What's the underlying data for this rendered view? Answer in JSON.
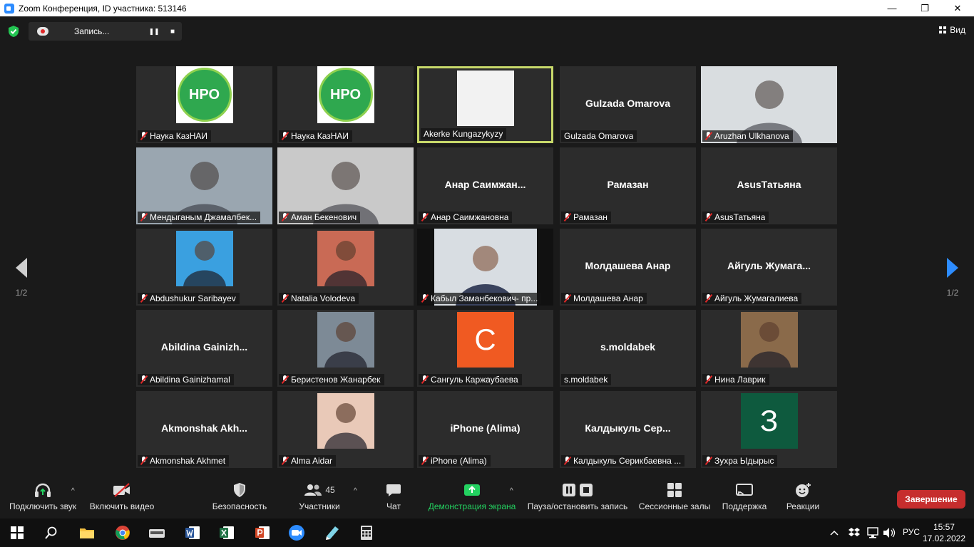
{
  "window": {
    "title": "Zoom Конференция, ID участника: 513146",
    "controls": [
      "—",
      "❐",
      "✕"
    ]
  },
  "recording": {
    "label": "Запись...",
    "pause": "❚❚",
    "stop": "■"
  },
  "view": {
    "label": "Вид"
  },
  "pagination": {
    "left": "1/2",
    "right": "1/2"
  },
  "tiles": [
    {
      "label": "Наука КазНАИ",
      "kind": "logo",
      "logo_text": "НРО",
      "muted": true
    },
    {
      "label": "Наука КазНАИ",
      "kind": "logo",
      "logo_text": "НРО",
      "muted": true
    },
    {
      "label": "Akerke Kungazykyzy",
      "kind": "white",
      "muted": false,
      "active": true
    },
    {
      "label": "Gulzada Omarova",
      "kind": "name",
      "big": "Gulzada Omarova",
      "muted": false
    },
    {
      "label": "Aruzhan Ulkhanova",
      "kind": "fullphoto",
      "bg": "#d9dde0",
      "muted": true
    },
    {
      "label": "Мендыганым Джамалбек...",
      "kind": "fullphoto",
      "bg": "#9aa6b0",
      "muted": true
    },
    {
      "label": "Аман Бекенович",
      "kind": "fullphoto",
      "bg": "#c9c9c9",
      "muted": true
    },
    {
      "label": "Анар Саимжановна",
      "kind": "name",
      "big": "Анар  Саимжан...",
      "muted": true
    },
    {
      "label": "Рамазан",
      "kind": "name",
      "big": "Рамазан",
      "muted": true
    },
    {
      "label": "AsusТатьяна",
      "kind": "name",
      "big": "AsusТатьяна",
      "muted": true
    },
    {
      "label": "Abdushukur Saribayev",
      "kind": "photo",
      "bg": "#3aa0e0",
      "muted": true
    },
    {
      "label": "Natalia Volodeva",
      "kind": "photo",
      "bg": "#c96a55",
      "muted": true
    },
    {
      "label": "Кабыл Заманбекович- пр...",
      "kind": "widephoto",
      "bg": "#d8dde2",
      "muted": true
    },
    {
      "label": "Молдашева Анар",
      "kind": "name",
      "big": "Молдашева Анар",
      "muted": true
    },
    {
      "label": "Айгуль Жумагалиева",
      "kind": "name",
      "big": "Айгуль  Жумага...",
      "muted": true
    },
    {
      "label": "Abildina Gainizhamal",
      "kind": "name",
      "big": "Abildina  Gainizh...",
      "muted": true
    },
    {
      "label": "Беристенов Жанарбек",
      "kind": "photo",
      "bg": "#7d8a96",
      "muted": true
    },
    {
      "label": "Сангуль Каржаубаева",
      "kind": "avatar",
      "letter": "С",
      "color": "#f05a22",
      "muted": true
    },
    {
      "label": "s.moldabek",
      "kind": "name",
      "big": "s.moldabek",
      "muted": false
    },
    {
      "label": "Нина Лаврик",
      "kind": "photo",
      "bg": "#8a6a4a",
      "muted": true
    },
    {
      "label": "Akmonshak Akhmet",
      "kind": "name",
      "big": "Akmonshak  Akh...",
      "muted": true
    },
    {
      "label": "Alma Aidar",
      "kind": "photo",
      "bg": "#e9c9b8",
      "muted": true
    },
    {
      "label": "iPhone (Alima)",
      "kind": "name",
      "big": "iPhone (Alima)",
      "muted": true
    },
    {
      "label": "Калдыкуль Серикбаевна ...",
      "kind": "name",
      "big": "Калдыкуль  Сер...",
      "muted": true
    },
    {
      "label": "Зухра Ыдырыс",
      "kind": "avatar",
      "letter": "З",
      "color": "#0e5a3e",
      "muted": true
    }
  ],
  "toolbar": {
    "audio": "Подключить звук",
    "video": "Включить видео",
    "security": "Безопасность",
    "participants": "Участники",
    "participants_count": "45",
    "chat": "Чат",
    "share": "Демонстрация экрана",
    "record": "Пауза/остановить запись",
    "breakout": "Сессионные залы",
    "support": "Поддержка",
    "reactions": "Реакции",
    "end": "Завершение"
  },
  "taskbar": {
    "lang": "РУС",
    "time": "15:57",
    "date": "17.02.2022"
  },
  "colors": {
    "accent": "#2d8cff",
    "active_border": "#c8d96a",
    "share_green": "#23d160",
    "end_red": "#c62d2d"
  }
}
